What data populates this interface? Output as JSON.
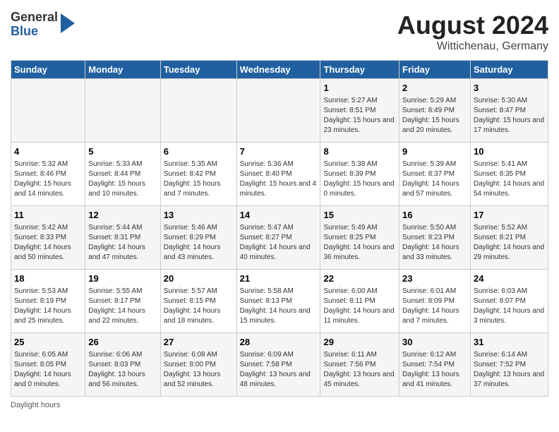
{
  "header": {
    "logo_general": "General",
    "logo_blue": "Blue",
    "title": "August 2024",
    "subtitle": "Wittichenau, Germany"
  },
  "columns": [
    "Sunday",
    "Monday",
    "Tuesday",
    "Wednesday",
    "Thursday",
    "Friday",
    "Saturday"
  ],
  "weeks": [
    [
      {
        "num": "",
        "detail": ""
      },
      {
        "num": "",
        "detail": ""
      },
      {
        "num": "",
        "detail": ""
      },
      {
        "num": "",
        "detail": ""
      },
      {
        "num": "1",
        "detail": "Sunrise: 5:27 AM\nSunset: 8:51 PM\nDaylight: 15 hours and 23 minutes."
      },
      {
        "num": "2",
        "detail": "Sunrise: 5:29 AM\nSunset: 8:49 PM\nDaylight: 15 hours and 20 minutes."
      },
      {
        "num": "3",
        "detail": "Sunrise: 5:30 AM\nSunset: 8:47 PM\nDaylight: 15 hours and 17 minutes."
      }
    ],
    [
      {
        "num": "4",
        "detail": "Sunrise: 5:32 AM\nSunset: 8:46 PM\nDaylight: 15 hours and 14 minutes."
      },
      {
        "num": "5",
        "detail": "Sunrise: 5:33 AM\nSunset: 8:44 PM\nDaylight: 15 hours and 10 minutes."
      },
      {
        "num": "6",
        "detail": "Sunrise: 5:35 AM\nSunset: 8:42 PM\nDaylight: 15 hours and 7 minutes."
      },
      {
        "num": "7",
        "detail": "Sunrise: 5:36 AM\nSunset: 8:40 PM\nDaylight: 15 hours and 4 minutes."
      },
      {
        "num": "8",
        "detail": "Sunrise: 5:38 AM\nSunset: 8:39 PM\nDaylight: 15 hours and 0 minutes."
      },
      {
        "num": "9",
        "detail": "Sunrise: 5:39 AM\nSunset: 8:37 PM\nDaylight: 14 hours and 57 minutes."
      },
      {
        "num": "10",
        "detail": "Sunrise: 5:41 AM\nSunset: 8:35 PM\nDaylight: 14 hours and 54 minutes."
      }
    ],
    [
      {
        "num": "11",
        "detail": "Sunrise: 5:42 AM\nSunset: 8:33 PM\nDaylight: 14 hours and 50 minutes."
      },
      {
        "num": "12",
        "detail": "Sunrise: 5:44 AM\nSunset: 8:31 PM\nDaylight: 14 hours and 47 minutes."
      },
      {
        "num": "13",
        "detail": "Sunrise: 5:46 AM\nSunset: 8:29 PM\nDaylight: 14 hours and 43 minutes."
      },
      {
        "num": "14",
        "detail": "Sunrise: 5:47 AM\nSunset: 8:27 PM\nDaylight: 14 hours and 40 minutes."
      },
      {
        "num": "15",
        "detail": "Sunrise: 5:49 AM\nSunset: 8:25 PM\nDaylight: 14 hours and 36 minutes."
      },
      {
        "num": "16",
        "detail": "Sunrise: 5:50 AM\nSunset: 8:23 PM\nDaylight: 14 hours and 33 minutes."
      },
      {
        "num": "17",
        "detail": "Sunrise: 5:52 AM\nSunset: 8:21 PM\nDaylight: 14 hours and 29 minutes."
      }
    ],
    [
      {
        "num": "18",
        "detail": "Sunrise: 5:53 AM\nSunset: 8:19 PM\nDaylight: 14 hours and 25 minutes."
      },
      {
        "num": "19",
        "detail": "Sunrise: 5:55 AM\nSunset: 8:17 PM\nDaylight: 14 hours and 22 minutes."
      },
      {
        "num": "20",
        "detail": "Sunrise: 5:57 AM\nSunset: 8:15 PM\nDaylight: 14 hours and 18 minutes."
      },
      {
        "num": "21",
        "detail": "Sunrise: 5:58 AM\nSunset: 8:13 PM\nDaylight: 14 hours and 15 minutes."
      },
      {
        "num": "22",
        "detail": "Sunrise: 6:00 AM\nSunset: 8:11 PM\nDaylight: 14 hours and 11 minutes."
      },
      {
        "num": "23",
        "detail": "Sunrise: 6:01 AM\nSunset: 8:09 PM\nDaylight: 14 hours and 7 minutes."
      },
      {
        "num": "24",
        "detail": "Sunrise: 6:03 AM\nSunset: 8:07 PM\nDaylight: 14 hours and 3 minutes."
      }
    ],
    [
      {
        "num": "25",
        "detail": "Sunrise: 6:05 AM\nSunset: 8:05 PM\nDaylight: 14 hours and 0 minutes."
      },
      {
        "num": "26",
        "detail": "Sunrise: 6:06 AM\nSunset: 8:03 PM\nDaylight: 13 hours and 56 minutes."
      },
      {
        "num": "27",
        "detail": "Sunrise: 6:08 AM\nSunset: 8:00 PM\nDaylight: 13 hours and 52 minutes."
      },
      {
        "num": "28",
        "detail": "Sunrise: 6:09 AM\nSunset: 7:58 PM\nDaylight: 13 hours and 48 minutes."
      },
      {
        "num": "29",
        "detail": "Sunrise: 6:11 AM\nSunset: 7:56 PM\nDaylight: 13 hours and 45 minutes."
      },
      {
        "num": "30",
        "detail": "Sunrise: 6:12 AM\nSunset: 7:54 PM\nDaylight: 13 hours and 41 minutes."
      },
      {
        "num": "31",
        "detail": "Sunrise: 6:14 AM\nSunset: 7:52 PM\nDaylight: 13 hours and 37 minutes."
      }
    ]
  ],
  "footer": {
    "daylight_label": "Daylight hours"
  }
}
